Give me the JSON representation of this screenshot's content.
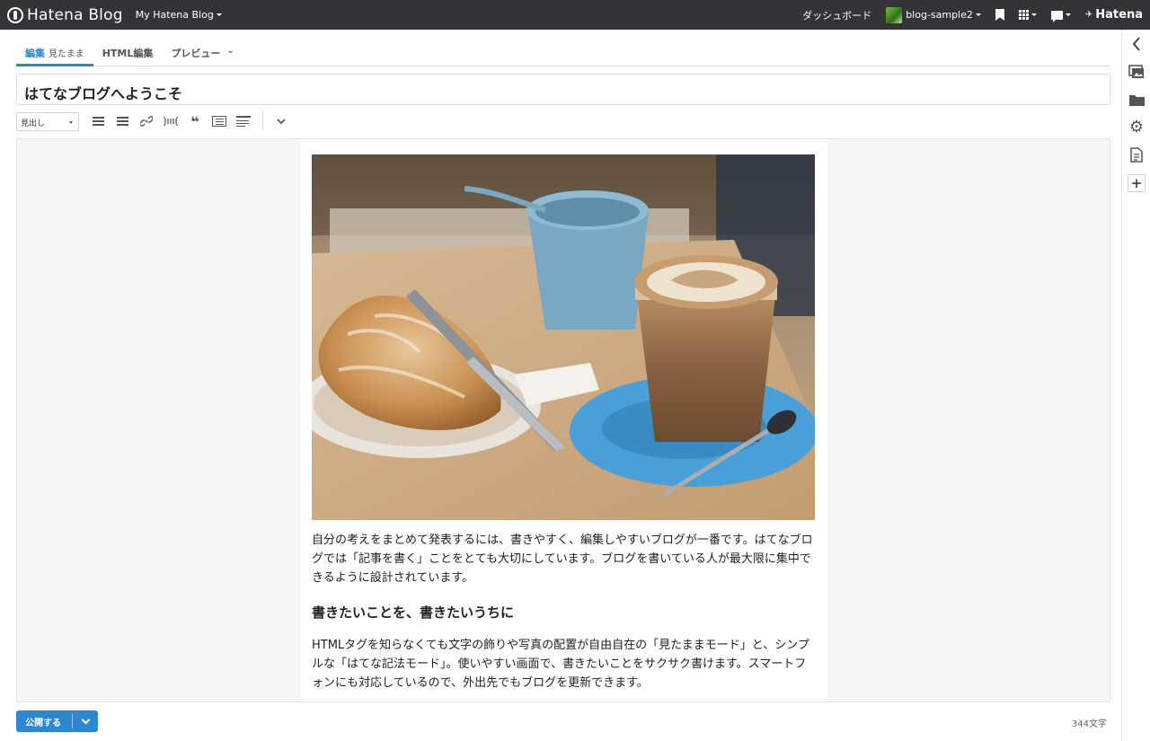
{
  "topbar": {
    "brand": "Hatena Blog",
    "my_blog": "My Hatena Blog",
    "dashboard": "ダッシュボード",
    "blog_name": "blog-sample2",
    "hatena": "Hatena"
  },
  "tabs": [
    {
      "label": "編集",
      "sub": "見たまま",
      "active": true
    },
    {
      "label": "HTML編集",
      "sub": ""
    },
    {
      "label": "プレビュー",
      "sub": ""
    }
  ],
  "title": "はてなブログへようこそ",
  "toolbar": {
    "heading_select": "見出し",
    "icons": [
      "unordered-list-icon",
      "ordered-list-icon",
      "link-icon",
      "more-divider-icon",
      "quote-icon",
      "table-of-contents-icon",
      "summary-icon",
      "chevron-down-icon"
    ]
  },
  "article": {
    "image_alt": "Croissant and latte on a table",
    "para1": "自分の考えをまとめて発表するには、書きやすく、編集しやすいブログが一番です。はてなブログでは「記事を書く」ことをとても大切にしています。ブログを書いている人が最大限に集中できるように設計されています。",
    "heading": "書きたいことを、書きたいうちに",
    "para2": "HTMLタグを知らなくても文字の飾りや写真の配置が自由自在の「見たままモード」と、シンプルな「はてな記法モード」。使いやすい画面で、書きたいことをサクサク書けます。スマートフォンにも対応しているので、外出先でもブログを更新できます。"
  },
  "sidebar": {
    "icons": [
      "collapse-chevron-icon",
      "photo-icon",
      "folder-icon",
      "settings-icon",
      "document-icon",
      "add-icon"
    ]
  },
  "footer": {
    "publish": "公開する",
    "char_count": "344文字"
  },
  "colors": {
    "topbar": "#323438",
    "accent": "#2a87d0",
    "editor_bg": "#f4f6f8"
  }
}
